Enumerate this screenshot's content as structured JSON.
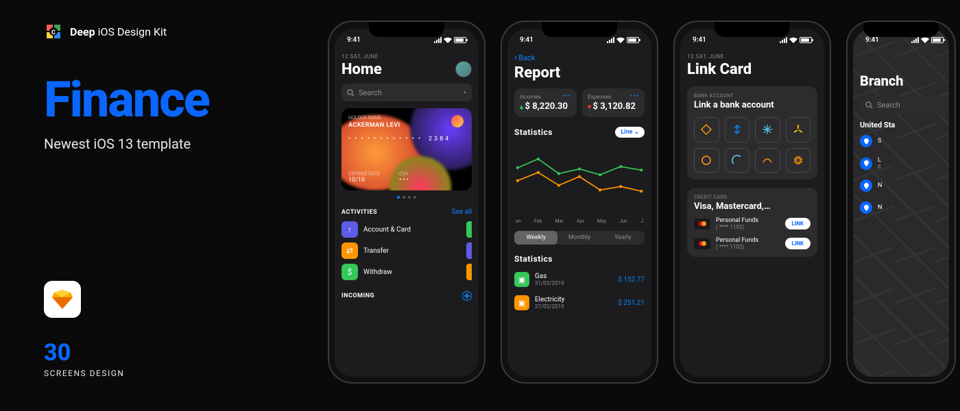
{
  "brand": {
    "name_bold": "Deep",
    "name_light": " iOS Design Kit"
  },
  "hero": {
    "title": "Finance",
    "subtitle": "Newest iOS 13 template"
  },
  "meta": {
    "count": "30",
    "count_label": "SCREENS DESIGN"
  },
  "status": {
    "time": "9:41"
  },
  "screen1": {
    "overline": "12 SAT, JUNE",
    "title": "Home",
    "search_placeholder": "Search",
    "card": {
      "holder_label": "HOLDER NAME",
      "holder_name": "ACKERMAN LEVI",
      "masked": "• • • •   • • • •   • • • •",
      "last4": "2384",
      "exp_label": "EXPIRED DATE",
      "exp": "10/10",
      "cvv_label": "CVV",
      "cvv": "• • •"
    },
    "activities_title": "ACTIVITIES",
    "see_all": "See all",
    "activities": [
      {
        "label": "Account & Card",
        "color": "#5e5ce6",
        "glyph": "↑"
      },
      {
        "label": "Transfer",
        "color": "#ff9500",
        "glyph": "⇄"
      },
      {
        "label": "Withdraw",
        "color": "#34c759",
        "glyph": "$"
      }
    ],
    "incoming_title": "INCOMING"
  },
  "screen2": {
    "back": "Back",
    "title": "Report",
    "tiles": [
      {
        "label": "Incomes",
        "value": "$ 8,220.30",
        "dir": "up"
      },
      {
        "label": "Expenses",
        "value": "$ 3,120.82",
        "dir": "down"
      }
    ],
    "stats_title": "Statistics",
    "toggle": "Line",
    "months": [
      "an",
      "Feb",
      "Mar",
      "Apr",
      "May",
      "Jun",
      "J"
    ],
    "segments": [
      "Weekly",
      "Monthly",
      "Yearly"
    ],
    "segment_active": 0,
    "list_title": "Statistics",
    "items": [
      {
        "name": "Gas",
        "date": "31/03/2019",
        "value": "$ 152.77",
        "color": "#34c759"
      },
      {
        "name": "Electricity",
        "date": "27/02/2019",
        "value": "$ 251.21",
        "color": "#ff9500"
      }
    ]
  },
  "screen3": {
    "overline": "12 SAT, JUNE",
    "title": "Link Card",
    "bank_over": "BANK ACCOUNT",
    "bank_title": "Link a bank account",
    "cc_over": "CREDIT CARD",
    "cc_title": "Visa, Mastercard,…",
    "cc_items": [
      {
        "name": "Personal Funds",
        "sub": "( **** 1102)",
        "btn": "LINK"
      },
      {
        "name": "Personal Funds",
        "sub": "( **** 1102)",
        "btn": "LINK"
      }
    ]
  },
  "screen4": {
    "title": "Branch",
    "search_placeholder": "Search",
    "country": "United Sta",
    "items": [
      {
        "name": "S",
        "sub": ""
      },
      {
        "name": "L",
        "sub": "8"
      },
      {
        "name": "N",
        "sub": ""
      },
      {
        "name": "N",
        "sub": ""
      }
    ]
  },
  "chart_data": {
    "type": "line",
    "categories": [
      "Jan",
      "Feb",
      "Mar",
      "Apr",
      "May",
      "Jun",
      "Jul"
    ],
    "series": [
      {
        "name": "Incomes",
        "color": "#34c759",
        "values": [
          70,
          85,
          60,
          68,
          58,
          72,
          66
        ]
      },
      {
        "name": "Expenses",
        "color": "#ff9500",
        "values": [
          48,
          62,
          40,
          55,
          32,
          38,
          30
        ]
      }
    ],
    "ylim": [
      0,
      100
    ]
  }
}
